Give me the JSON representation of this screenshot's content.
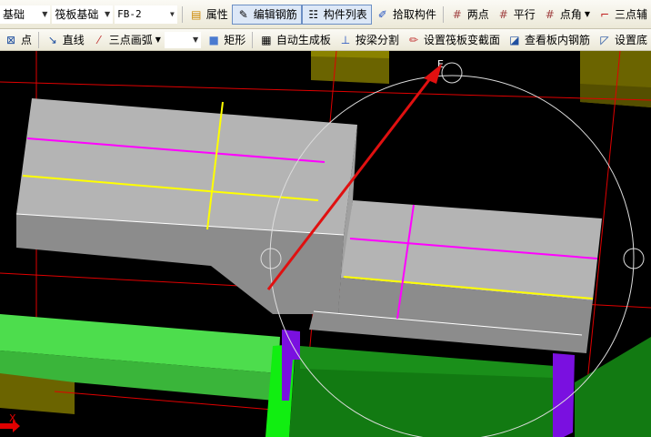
{
  "toolbar1": {
    "combo_floor": "基础",
    "combo_type": "筏板基础",
    "combo_name": "FB-2",
    "properties": "属性",
    "edit_rebar": "编辑钢筋",
    "component_list": "构件列表",
    "pick_component": "拾取构件",
    "two_points": "两点",
    "parallel": "平行",
    "point_angle": "点角",
    "three_point_axis": "三点辅"
  },
  "toolbar2": {
    "point": "点",
    "line": "直线",
    "three_point_arc": "三点画弧",
    "combo_empty": "",
    "rectangle": "矩形",
    "auto_generate": "自动生成板",
    "split_by_beam": "按梁分割",
    "set_raft_section": "设置筏板变截面",
    "view_slab_rebar": "查看板内钢筋",
    "set_more": "设置底"
  },
  "canvas": {
    "axis_label_x": "X",
    "snap_label": "E"
  },
  "colors": {
    "slab": "#b4b4b4",
    "beam_light": "#4ddd4d",
    "beam_dark": "#127a12",
    "column": "#7a10e0",
    "olive": "#6b6400",
    "grid": "#e00000",
    "arrow": "#e01010"
  }
}
